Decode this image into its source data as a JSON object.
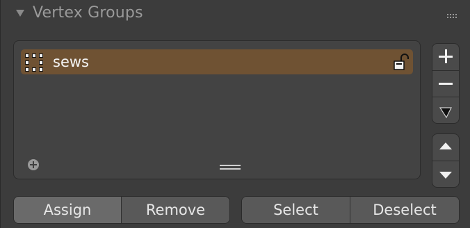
{
  "header": {
    "title": "Vertex Groups"
  },
  "list": {
    "items": [
      {
        "label": "sews",
        "selected": true,
        "lock_icon": "unlock-icon",
        "type_icon": "vertex-group-icon"
      }
    ]
  },
  "side_buttons": {
    "add": "plus-icon",
    "remove": "minus-icon",
    "specials": "dropdown-icon",
    "move_up": "chevron-up-icon",
    "move_down": "chevron-down-icon"
  },
  "actions": {
    "assign": "Assign",
    "remove": "Remove",
    "select": "Select",
    "deselect": "Deselect"
  },
  "colors": {
    "panel_bg": "#3c3c3c",
    "list_bg": "#434343",
    "selected_row": "#6f5233",
    "button_bg": "#595959",
    "text": "#e6e6e6",
    "header_text": "#9a9a9a"
  }
}
